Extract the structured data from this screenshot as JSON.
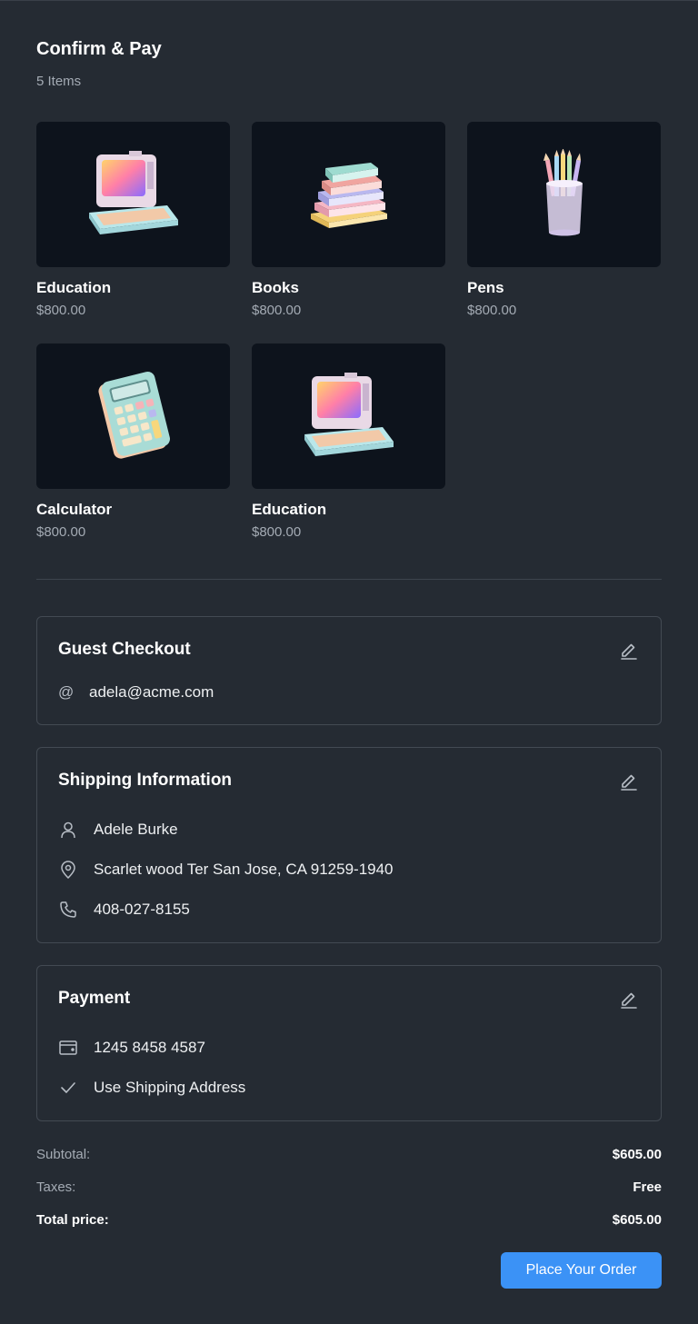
{
  "header": {
    "title": "Confirm & Pay",
    "item_count": "5 Items"
  },
  "products": [
    {
      "name": "Education",
      "price": "$800.00",
      "image": "retro-computer-icon"
    },
    {
      "name": "Books",
      "price": "$800.00",
      "image": "book-stack-icon"
    },
    {
      "name": "Pens",
      "price": "$800.00",
      "image": "pencil-cup-icon"
    },
    {
      "name": "Calculator",
      "price": "$800.00",
      "image": "calculator-icon"
    },
    {
      "name": "Education",
      "price": "$800.00",
      "image": "retro-computer-icon"
    }
  ],
  "guest": {
    "title": "Guest Checkout",
    "email": "adela@acme.com",
    "at_symbol": "@"
  },
  "shipping": {
    "title": "Shipping Information",
    "name": "Adele Burke",
    "address": "Scarlet wood Ter San Jose, CA 91259-1940",
    "phone": "408-027-8155"
  },
  "payment": {
    "title": "Payment",
    "card_number": "1245 8458 4587",
    "billing": "Use Shipping Address"
  },
  "summary": {
    "subtotal_label": "Subtotal:",
    "subtotal_value": "$605.00",
    "taxes_label": "Taxes:",
    "taxes_value": "Free",
    "total_label": "Total price:",
    "total_value": "$605.00"
  },
  "actions": {
    "place_order": "Place Your Order"
  },
  "colors": {
    "background": "#252b33",
    "thumb_bg": "#0d131c",
    "accent": "#3b92f6",
    "muted_text": "#a4abb4"
  }
}
